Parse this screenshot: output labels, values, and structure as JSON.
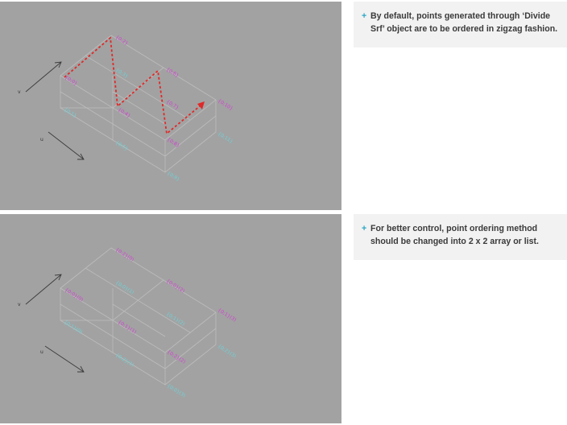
{
  "notes": [
    {
      "bullet": "+",
      "text": "By default, points generated through ‘Divide Srf’ object are to be ordered in zigzag fashion."
    },
    {
      "bullet": "+",
      "text": "For better control, point ordering method should be changed into 2 x 2 array or list."
    }
  ],
  "viewport1": {
    "axis_u": "u",
    "axis_v": "v",
    "point_labels": [
      "{0;0}",
      "{0;1}",
      "{0;2}",
      "{0;3}",
      "{0;4}",
      "{0;5}",
      "{0;6}",
      "{0;7}",
      "{0;8}",
      "{0;9}",
      "{0;10}",
      "{0;11}"
    ]
  },
  "viewport2": {
    "axis_u": "u",
    "axis_v": "v",
    "point_labels": [
      "{0;0}(0)",
      "{0;1}(0)",
      "{0;2}(0)",
      "{0;0}(1)",
      "{0;1}(1)",
      "{0;2}(1)",
      "{0;0}(2)",
      "{0;1}(2)",
      "{0;2}(2)",
      "{0;0}(3)",
      "{0;1}(3)",
      "{0;2}(3)"
    ]
  },
  "colors": {
    "viewport_bg": "#a2a2a2",
    "note_bg": "#f2f2f2",
    "bullet": "#2aa7c4",
    "zigzag": "#e02828",
    "label_magenta": "#d23fd2",
    "label_cyan": "#6fd2d8"
  }
}
